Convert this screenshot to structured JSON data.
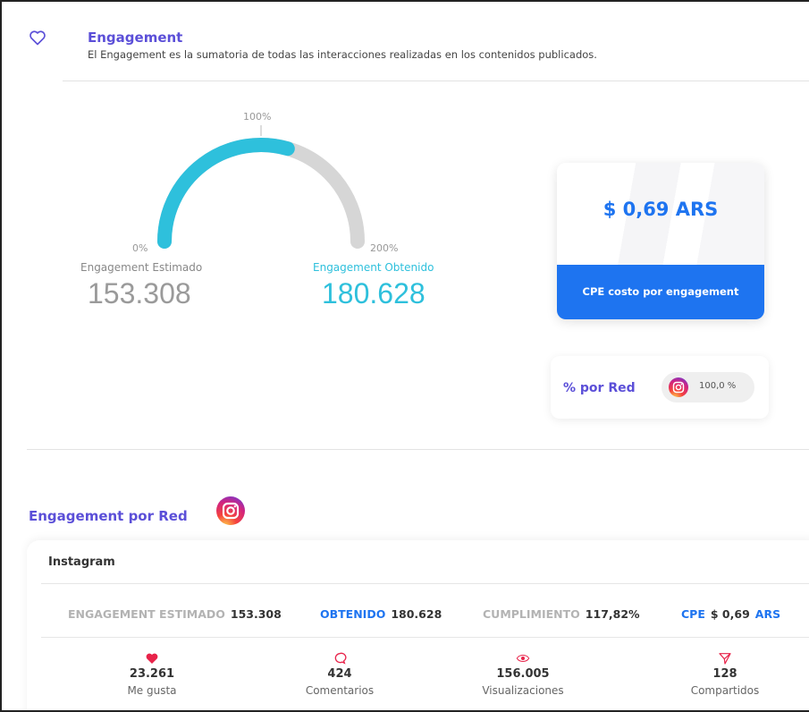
{
  "engagement": {
    "title": "Engagement",
    "description": "El Engagement es la sumatoria de todas las interacciones realizadas en los contenidos publicados.",
    "gauge": {
      "label_min": "0%",
      "label_mid": "100%",
      "label_max": "200%",
      "fill_fraction": 0.589,
      "fill_color": "#2ec0dc",
      "track_color": "#d6d6d6"
    },
    "estimado_label": "Engagement Estimado",
    "estimado_value": "153.308",
    "obtenido_label": "Engagement Obtenido",
    "obtenido_value": "180.628"
  },
  "cpe_card": {
    "value": "$ 0,69 ARS",
    "label": "CPE costo por engagement",
    "accent": "#1e74f0"
  },
  "por_red": {
    "label": "% por Red",
    "network_icon": "instagram-icon",
    "percent": "100,0 %"
  },
  "engagement_por_red": {
    "title": "Engagement por Red",
    "active_tab_icon": "instagram-icon",
    "network_name": "Instagram",
    "stats": {
      "estimado_label": "ENGAGEMENT ESTIMADO",
      "estimado_value": "153.308",
      "obtenido_label": "OBTENIDO",
      "obtenido_value": "180.628",
      "cumplimiento_label": "CUMPLIMIENTO",
      "cumplimiento_value": "117,82%",
      "cpe_label": "CPE",
      "cpe_value": "$ 0,69",
      "cpe_currency": "ARS"
    },
    "metrics": [
      {
        "icon": "heart-filled-icon",
        "value": "23.261",
        "label": "Me gusta",
        "color": "#e8234a"
      },
      {
        "icon": "comment-icon",
        "value": "424",
        "label": "Comentarios",
        "color": "#e8234a"
      },
      {
        "icon": "eye-icon",
        "value": "156.005",
        "label": "Visualizaciones",
        "color": "#e8234a"
      },
      {
        "icon": "send-icon",
        "value": "128",
        "label": "Compartidos",
        "color": "#e8234a"
      }
    ]
  }
}
